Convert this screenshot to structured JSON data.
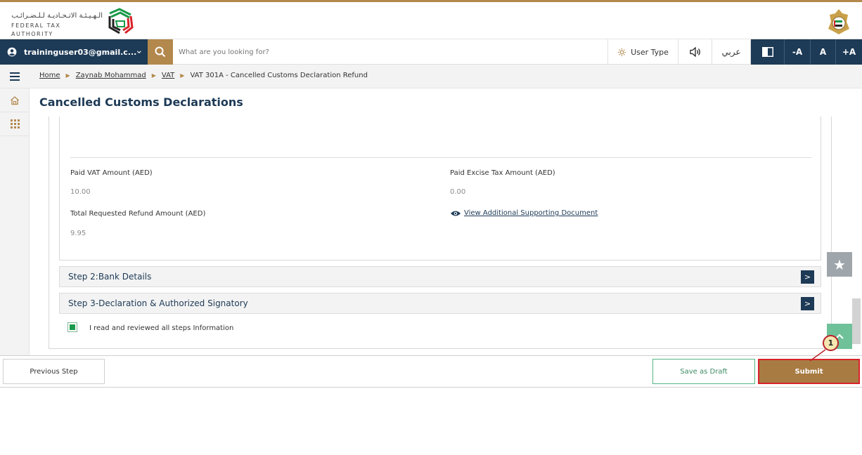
{
  "header": {
    "logo_arabic": "الـهـيـئـة الاتـحـاديـة لـلـضـرائـب",
    "logo_english": "FEDERAL TAX AUTHORITY"
  },
  "toolbar": {
    "user_email": "traininguser03@gmail.c...",
    "search_placeholder": "What are you looking for?",
    "user_type_label": "User Type",
    "language_label": "عربي",
    "font_decrease": "-A",
    "font_normal": "A",
    "font_increase": "+A"
  },
  "breadcrumb": {
    "items": [
      "Home",
      "Zaynab Mohammad",
      "VAT",
      "VAT 301A - Cancelled Customs Declaration Refund"
    ]
  },
  "page": {
    "title": "Cancelled Customs Declarations"
  },
  "details": {
    "paid_vat_label": "Paid VAT Amount (AED)",
    "paid_vat_value": "10.00",
    "paid_excise_label": "Paid Excise Tax Amount (AED)",
    "paid_excise_value": "0.00",
    "total_refund_label": "Total Requested Refund Amount (AED)",
    "total_refund_value": "9.95",
    "supporting_doc_link": "View Additional Supporting Document"
  },
  "steps": [
    {
      "label": "Step 2:Bank Details",
      "button": ">"
    },
    {
      "label": "Step 3-Declaration & Authorized Signatory",
      "button": ">"
    }
  ],
  "confirmation": {
    "checked": true,
    "label": "I read and reviewed all steps Information"
  },
  "footer": {
    "previous_label": "Previous Step",
    "draft_label": "Save as Draft",
    "submit_label": "Submit"
  },
  "annotation": {
    "callout_number": "1"
  },
  "colors": {
    "brand_navy": "#1d3a56",
    "brand_gold": "#b3884c",
    "submit_bg": "#a87b43",
    "highlight_red": "#d8232a",
    "success_green": "#1a9a4a"
  },
  "icons": {
    "user": "user-avatar-icon",
    "search": "search-icon",
    "user_type": "gear-icon",
    "speaker": "speaker-icon",
    "contrast": "contrast-icon",
    "menu": "hamburger-icon",
    "home": "home-icon",
    "apps": "grid-icon",
    "eye": "eye-icon",
    "favorite": "star-icon",
    "scroll_top": "chevron-up-icon"
  }
}
